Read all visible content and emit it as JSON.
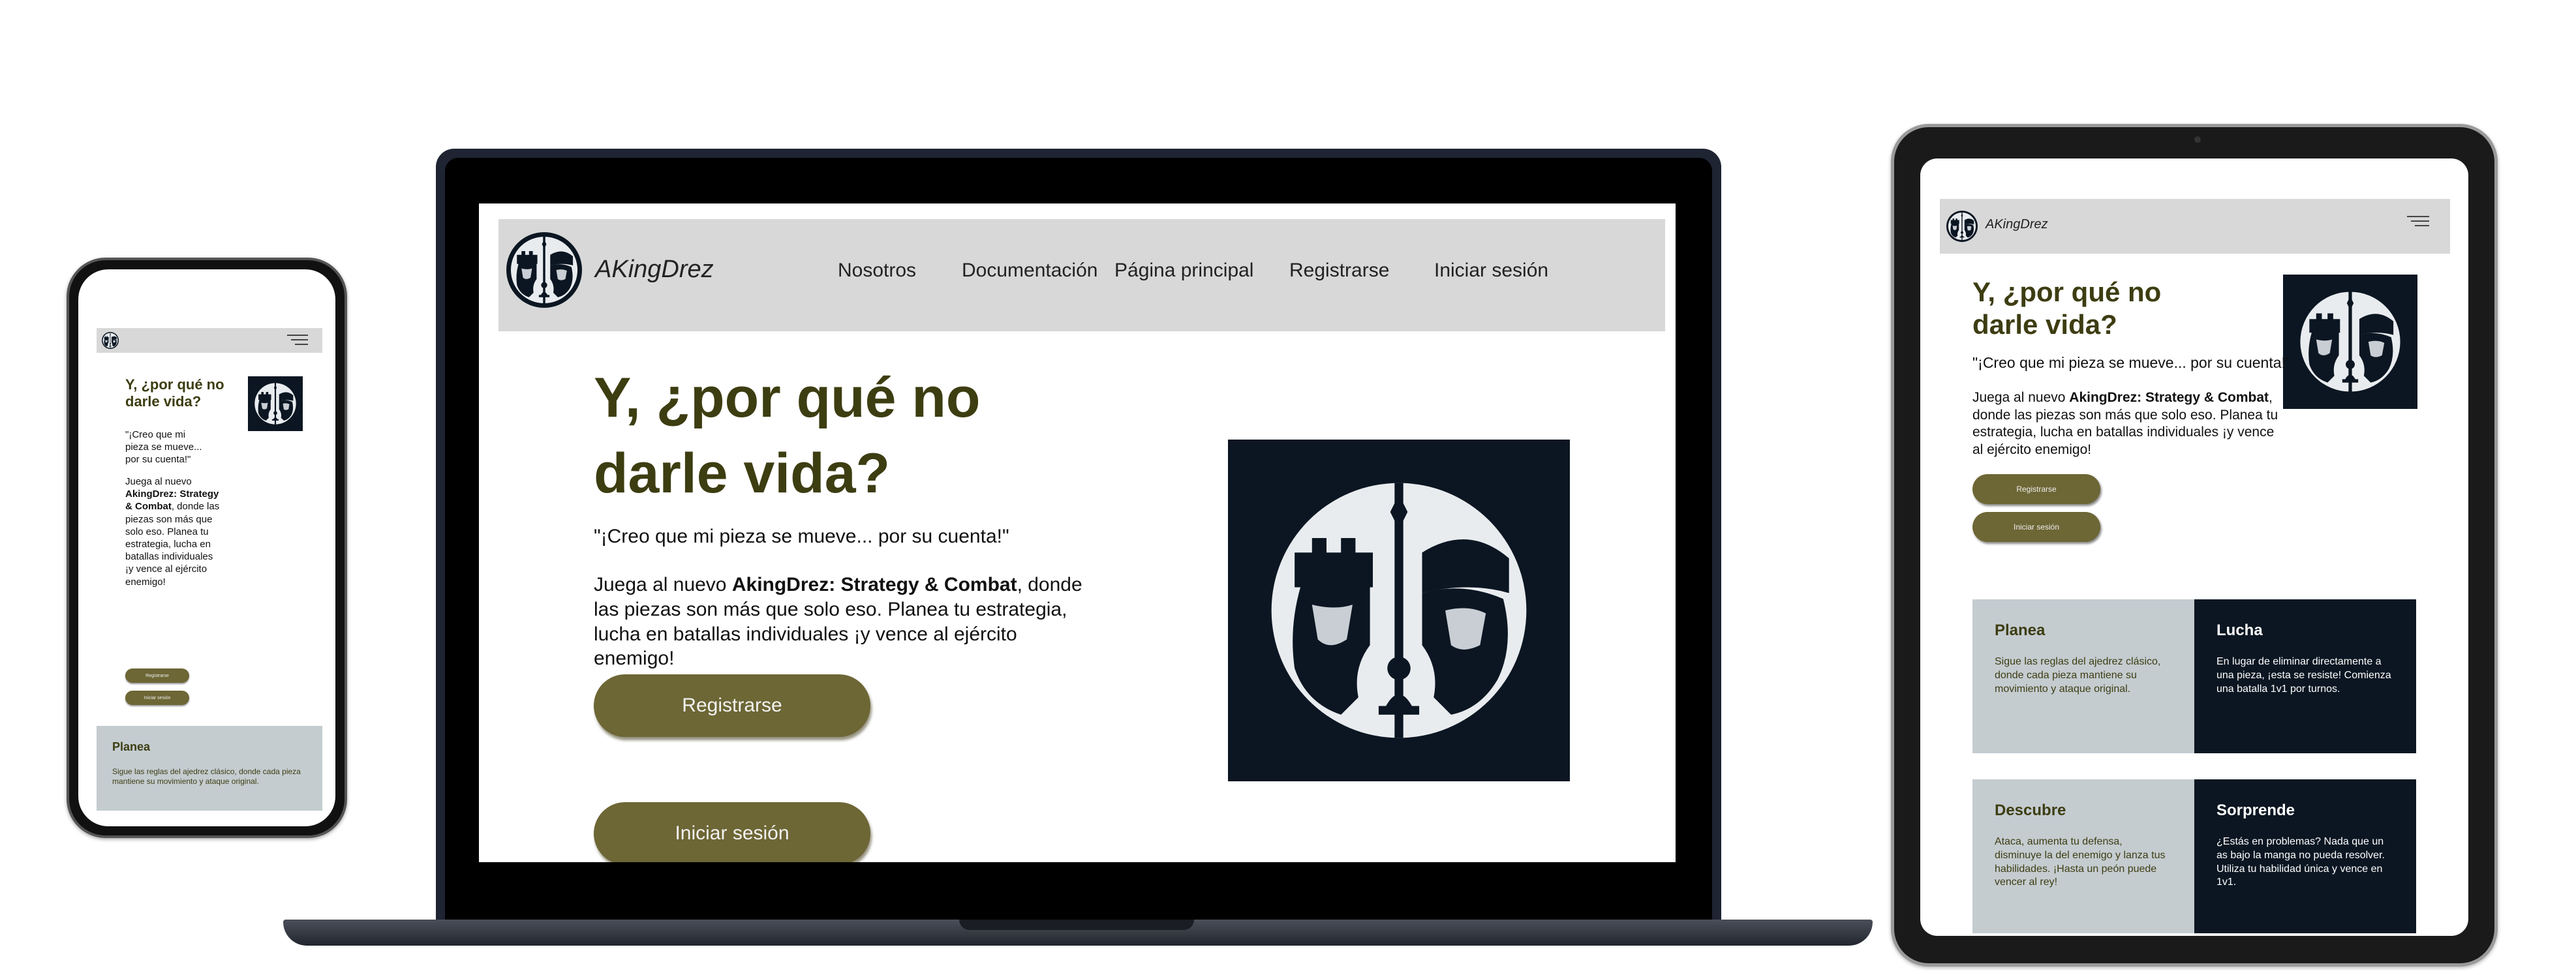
{
  "brand": "AKingDrez",
  "nav": {
    "links": [
      "Nosotros",
      "Documentación",
      "Página principal",
      "Registrarse",
      "Iniciar sesión"
    ]
  },
  "hero": {
    "title": "Y, ¿por qué no darle vida?",
    "quote": "\"¡Creo que mi pieza se mueve... por su cuenta!\"",
    "desc_prefix": "Juega al nuevo ",
    "desc_bold": "AkingDrez: Strategy & Combat",
    "desc_suffix": ", donde las piezas son más que solo eso. Planea tu estrategia, lucha en batallas individuales ¡y vence al ejército enemigo!",
    "register_button": "Registrarse",
    "login_button": "Iniciar sesión"
  },
  "features": [
    {
      "title": "Planea",
      "text": "Sigue las reglas del ajedrez clásico, donde cada pieza mantiene su movimiento y ataque original."
    },
    {
      "title": "Lucha",
      "text": "En lugar de eliminar directamente a una pieza, ¡esta se resiste! Comienza una batalla 1v1 por turnos."
    },
    {
      "title": "Descubre",
      "text": "Ataca, aumenta tu defensa, disminuye la del enemigo y lanza tus habilidades. ¡Hasta un peón puede vencer al rey!"
    },
    {
      "title": "Sorprende",
      "text": "¿Estás en problemas? Nada que un as bajo la manga no pueda resolver. Utiliza tu habilidad única y vence en 1v1."
    }
  ],
  "colors": {
    "accent_olive": "#6d6635",
    "title_olive": "#3d3d12",
    "navy": "#0b1622",
    "nav_gray": "#d8d8d8",
    "card_gray": "#c4ccd0"
  },
  "icons": {
    "logo": "chess-knights-emblem-icon",
    "menu": "hamburger-menu-icon"
  }
}
